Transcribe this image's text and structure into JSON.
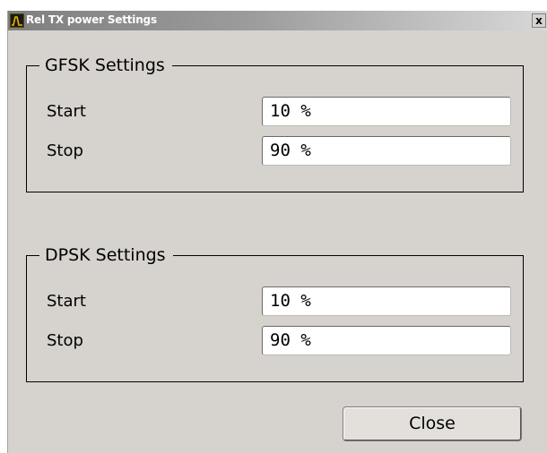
{
  "window": {
    "title": "Rel TX power Settings",
    "close_glyph": "x"
  },
  "gfsk": {
    "title": "GFSK Settings",
    "start_label": "Start",
    "start_value": "10 %",
    "stop_label": "Stop",
    "stop_value": "90 %"
  },
  "dpsk": {
    "title": "DPSK Settings",
    "start_label": "Start",
    "start_value": "10 %",
    "stop_label": "Stop",
    "stop_value": "90 %"
  },
  "footer": {
    "close_label": "Close"
  },
  "icons": {
    "app_icon": "spectrum-analyzer-icon",
    "window_close": "close-icon"
  },
  "colors": {
    "dialog_background": "#d6d3ce",
    "titlebar_start": "#7f7f7f",
    "titlebar_end": "#d8d8d8",
    "app_icon_trace": "#e8b800"
  }
}
